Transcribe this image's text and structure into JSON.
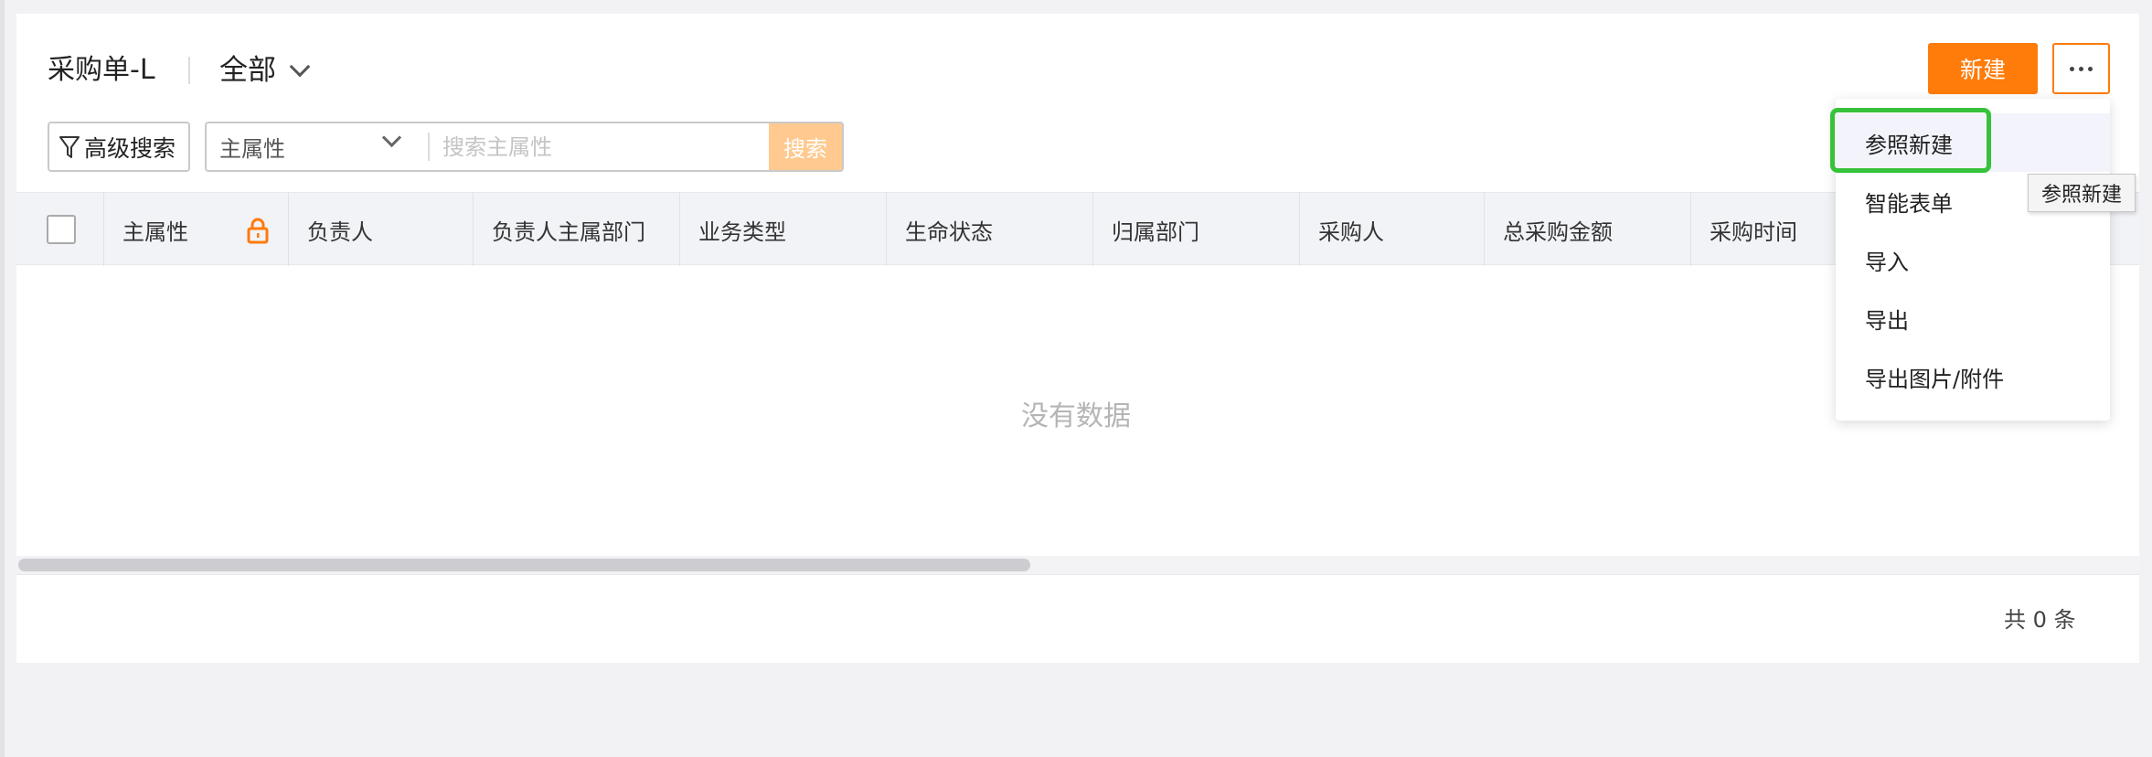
{
  "header": {
    "title": "采购单-L",
    "view": "全部",
    "new_button": "新建"
  },
  "search": {
    "advanced_label": "高级搜索",
    "field_selected": "主属性",
    "placeholder": "搜索主属性",
    "search_button": "搜索"
  },
  "table": {
    "columns": [
      "主属性",
      "负责人",
      "负责人主属部门",
      "业务类型",
      "生命状态",
      "归属部门",
      "采购人",
      "总采购金额",
      "采购时间"
    ],
    "empty_text": "没有数据",
    "total_text": "共 0 条"
  },
  "more_menu": {
    "items": [
      "参照新建",
      "智能表单",
      "导入",
      "导出",
      "导出图片/附件"
    ],
    "tooltip": "参照新建"
  },
  "colors": {
    "accent": "#ff7b0a",
    "highlight": "#36c23a"
  }
}
